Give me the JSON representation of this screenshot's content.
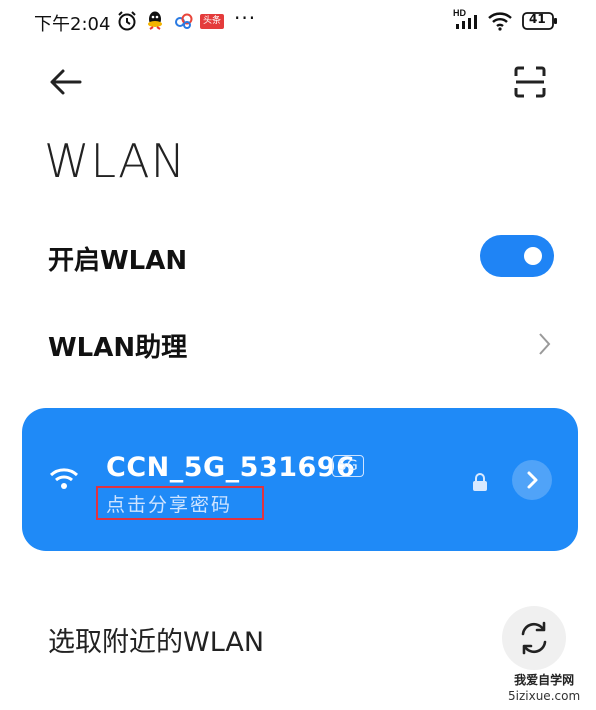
{
  "status_bar": {
    "time": "下午2:04",
    "icons": [
      "alarm-icon",
      "qq-icon",
      "cloud-icon",
      "toutiao-app-icon",
      "more-dots-icon",
      "hd-signal-icon",
      "wifi-icon",
      "battery-icon"
    ],
    "toutiao_label": "头条",
    "more": "···",
    "hd": "HD",
    "battery": "41"
  },
  "header": {
    "title": "WLAN",
    "back_icon": "back-arrow-icon",
    "scan_icon": "scan-qr-icon"
  },
  "settings": {
    "enable_wlan": {
      "label": "开启WLAN",
      "on": true
    },
    "assistant": {
      "label": "WLAN助理"
    }
  },
  "connected_network": {
    "ssid": "CCN_5G_531696",
    "band": "5G",
    "share_hint": "点击分享密码",
    "secured": true
  },
  "nearby": {
    "label": "选取附近的WLAN"
  },
  "watermark": {
    "line1": "我爱自学网",
    "line2": "5izixue.com"
  },
  "colors": {
    "accent": "#1f84f5",
    "card": "#1f8af7",
    "highlight": "#e03340"
  }
}
